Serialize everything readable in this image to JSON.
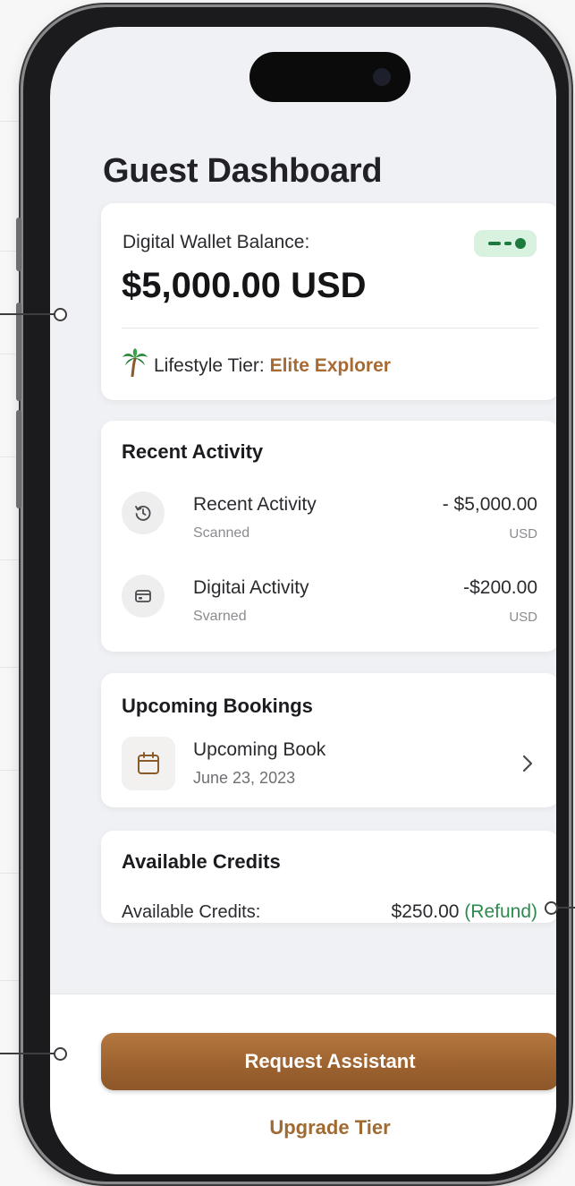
{
  "app": {
    "title": "Guest Dashboard"
  },
  "wallet": {
    "label": "Digital Wallet Balance:",
    "amount": "$5,000.00 USD",
    "toggle_icon": "toggle-switch-icon",
    "tier_icon": "palm-tree-icon",
    "tier_label": "Lifestyle Tier:",
    "tier_value": "Elite Explorer"
  },
  "activity": {
    "title": "Recent Activity",
    "items": [
      {
        "name": "Recent Activity",
        "status": "Scanned",
        "amount": "- $5,000.00",
        "currency": "USD",
        "icon": "history-clock-icon"
      },
      {
        "name": "Digitai Activity",
        "status": "Svarned",
        "amount": "-$200.00",
        "currency": "USD",
        "icon": "wallet-card-icon"
      }
    ]
  },
  "bookings": {
    "title": "Upcoming Bookings",
    "item": {
      "name": "Upcoming Book",
      "date": "June 23, 2023",
      "icon": "calendar-icon"
    }
  },
  "credits": {
    "title": "Available Credits",
    "label": "Available Credits:",
    "value": "$250.00",
    "note": "(Refund)"
  },
  "actions": {
    "primary": "Request Assistant",
    "secondary": "Upgrade Tier"
  },
  "colors": {
    "accent": "#a76a33",
    "button": "#9d6330",
    "positive": "#2d8a4e",
    "background": "#eff1f4"
  }
}
